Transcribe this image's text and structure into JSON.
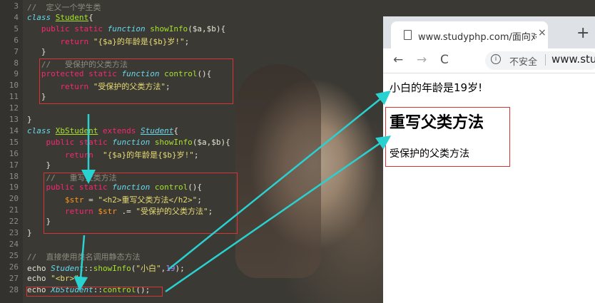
{
  "editor": {
    "lines": [
      {
        "n": "3",
        "html": "<span class='cmt'>//  定义一个学生类</span>"
      },
      {
        "n": "4",
        "html": "<span class='fn'>class</span> <span class='cls'>Student</span>{"
      },
      {
        "n": "5",
        "html": "   <span class='kw'>public static</span> <span class='fn'>function</span> <span class='call'>showInfo</span>($a,$b){"
      },
      {
        "n": "6",
        "html": "       <span class='kw'>return</span> <span class='str'>\"{$a}的年龄是{$b}岁!\"</span>;"
      },
      {
        "n": "7",
        "html": "   }"
      },
      {
        "n": "8",
        "html": "   <span class='cmt'>//   受保护的父类方法</span>"
      },
      {
        "n": "9",
        "html": "   <span class='kw'>protected static</span> <span class='fn'>function</span> <span class='call'>control</span>(){"
      },
      {
        "n": "10",
        "html": "       <span class='kw'>return</span> <span class='str'>\"受保护的父类方法\"</span>;"
      },
      {
        "n": "11",
        "html": "   }"
      },
      {
        "n": "12",
        "html": ""
      },
      {
        "n": "13",
        "html": "}"
      },
      {
        "n": "14",
        "html": "<span class='fn'>class</span> <span class='cls'>XbStudent</span> <span class='kw'>extends</span> <span class='fn' style='text-decoration:underline'>Student</span>{"
      },
      {
        "n": "15",
        "html": "    <span class='kw'>public static</span> <span class='fn'>function</span> <span class='call'>showInfo</span>($a,$b){"
      },
      {
        "n": "16",
        "html": "        <span class='kw'>return</span>  <span class='str'>\"{$a}的年龄是{$b}岁!\"</span>;"
      },
      {
        "n": "17",
        "html": "    }"
      },
      {
        "n": "18",
        "html": "    <span class='cmt'>//   重写父类方法</span>"
      },
      {
        "n": "19",
        "html": "    <span class='kw'>public static</span> <span class='fn'>function</span> <span class='call'>control</span>(){"
      },
      {
        "n": "20",
        "html": "        <span class='var'>$str</span> = <span class='str'>\"&lt;h2&gt;重写父类方法&lt;/h2&gt;\"</span>;"
      },
      {
        "n": "21",
        "html": "        <span class='kw'>return</span> <span class='var'>$str</span> .= <span class='str'>\"受保护的父类方法\"</span>;"
      },
      {
        "n": "22",
        "html": "    }"
      },
      {
        "n": "23",
        "html": "}"
      },
      {
        "n": "24",
        "html": ""
      },
      {
        "n": "25",
        "html": "<span class='cmt'>//  直接使用类名调用静态方法</span>"
      },
      {
        "n": "26",
        "html": "echo <span class='fn'>Student</span>::<span class='call'>showInfo</span>(<span class='str'>\"小白\"</span>,<span class='num'>19</span>);"
      },
      {
        "n": "27",
        "html": "echo <span class='str'>\"&lt;br&gt;\"</span>;"
      },
      {
        "n": "28",
        "html": "echo <span class='fn'>XbStudent</span>::<span class='call'>control</span>();"
      }
    ]
  },
  "browser": {
    "tab_title": "www.studyphp.com/面向对象/c",
    "tab_close": "×",
    "new_tab": "+",
    "back": "←",
    "forward": "→",
    "reload": "C",
    "info": "i",
    "insecure_label": "不安全",
    "url": "www.stud"
  },
  "page": {
    "line1": "小白的年龄是19岁!",
    "heading": "重写父类方法",
    "line2": "受保护的父类方法"
  },
  "colors": {
    "highlight_box": "#d93434",
    "arrow": "#2ad1d1"
  }
}
